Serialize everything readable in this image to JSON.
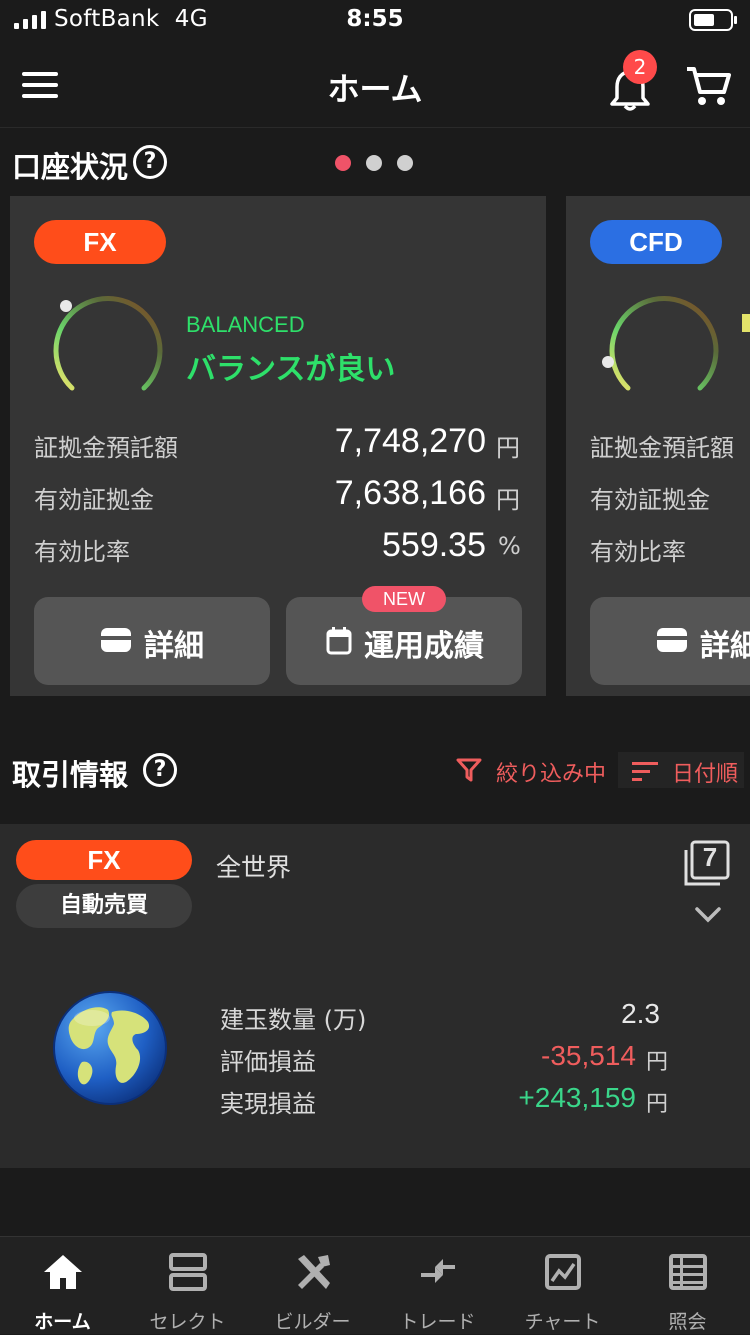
{
  "status_bar": {
    "carrier": "SoftBank",
    "network": "4G",
    "time": "8:55"
  },
  "header": {
    "title": "ホーム",
    "notification_count": "2"
  },
  "account_status": {
    "title": "口座状況",
    "help": "?",
    "page_dots": 3,
    "active_dot": 0,
    "fx_card": {
      "tag": "FX",
      "tag_color": "#ff4d1a",
      "balance_en": "BALANCED",
      "balance_ja": "バランスが良い",
      "status_color": "#2ee06a",
      "rows": [
        {
          "label": "証拠金預託額",
          "value": "7,748,270",
          "unit": "円"
        },
        {
          "label": "有効証拠金",
          "value": "7,638,166",
          "unit": "円"
        },
        {
          "label": "有効比率",
          "value": "559.35",
          "unit": "%"
        }
      ],
      "btn_detail": "詳細",
      "btn_performance": "運用成績",
      "new_badge": "NEW"
    },
    "cfd_card": {
      "tag": "CFD",
      "tag_color": "#2b6fe3",
      "rows": [
        {
          "label": "証拠金預託額"
        },
        {
          "label": "有効証拠金"
        },
        {
          "label": "有効比率"
        }
      ],
      "btn_detail": "詳細"
    }
  },
  "trade_info": {
    "title": "取引情報",
    "help": "?",
    "filter_label": "絞り込み中",
    "sort_label": "日付順",
    "item": {
      "tag": "FX",
      "type": "自動売買",
      "name": "全世界",
      "count": "7",
      "rows": [
        {
          "label": "建玉数量 (万)",
          "value": "2.3",
          "unit": ""
        },
        {
          "label": "評価損益",
          "value": "-35,514",
          "unit": "円"
        },
        {
          "label": "実現損益",
          "value": "+243,159",
          "unit": "円"
        }
      ]
    }
  },
  "bottom_nav": [
    {
      "label": "ホーム",
      "icon": "home-icon",
      "active": true
    },
    {
      "label": "セレクト",
      "icon": "select-icon",
      "active": false
    },
    {
      "label": "ビルダー",
      "icon": "builder-icon",
      "active": false
    },
    {
      "label": "トレード",
      "icon": "trade-icon",
      "active": false
    },
    {
      "label": "チャート",
      "icon": "chart-icon",
      "active": false
    },
    {
      "label": "照会",
      "icon": "list-icon",
      "active": false
    }
  ]
}
